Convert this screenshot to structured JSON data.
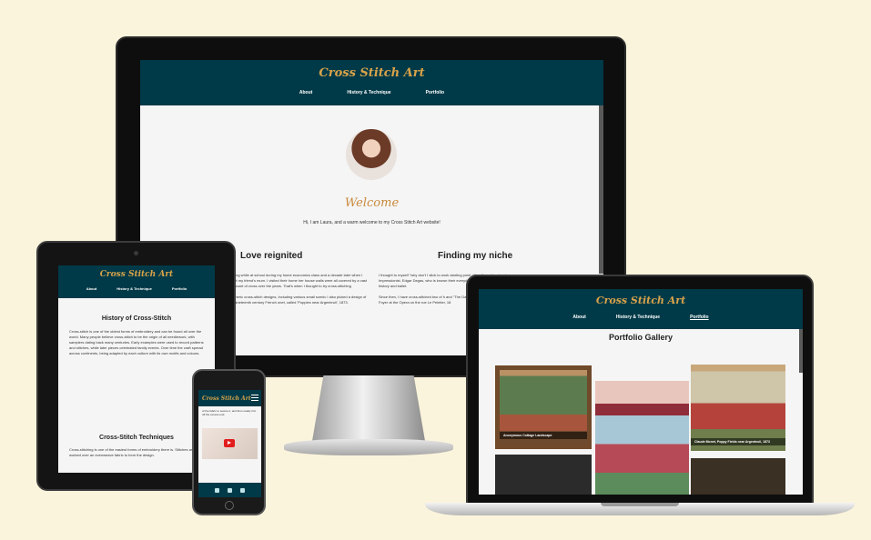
{
  "site": {
    "title": "Cross Stitch Art",
    "nav": [
      "About",
      "History & Technique",
      "Portfolio"
    ]
  },
  "monitor": {
    "welcome_title": "Welcome",
    "welcome_text": "Hi, I am Laura, and a warm welcome to my Cross Stitch Art website!",
    "col1_title": "Love reignited",
    "col1_text_1": "ching while at school during my home economics class and a decade later when I met my friend's mum. I visited their home her house walls were all covered by a vast amount of cross over the years. That's when I thought to try cross-stitching",
    "col1_text_2": "generic cross-stitch designs, including various small scenic I also picked a design of a nineteenth century French onet, called 'Poppies near Argenteuil', 1873.",
    "col2_title": "Finding my niche",
    "col2_text_1": "I thought to myself \"why don't I stick to work starting point other than choosing to Impressionist, Edgar Degas, who is known their everyday day lives. This way I would history and ballet.",
    "col2_text_2": "Since then, I have cross-stitched two of h and \"The Dancing class\", 1870, and I am Foyer at the Opera on the rue Le Peletier, 18"
  },
  "tablet": {
    "history_title": "History of Cross-Stitch",
    "history_text": "Cross-stitch is one of the oldest forms of embroidery and can be found all over the world. Many people believe cross-stitch to be the origin of all needlework, with samplers dating back many centuries. Early examples were used to record patterns and stitches, while later pieces celebrated family events. Over time the craft spread across continents, being adapted by each culture with its own motifs and colours.",
    "techniques_title": "Cross-Stitch Techniques",
    "techniques_text": "Cross-stitching is one of the easiest forms of embroidery there is. Stitches are worked over an evenweave fabric to form the design."
  },
  "phone": {
    "text": "of the fabric to secure it, and then neatly trim off the excess end."
  },
  "laptop": {
    "gallery_title": "Portfolio Gallery",
    "art_1_label": "Anonymous Cottage Landscape",
    "art_3_label": "Claude Monet, Poppy Fields near Argenteuil, 1873"
  }
}
